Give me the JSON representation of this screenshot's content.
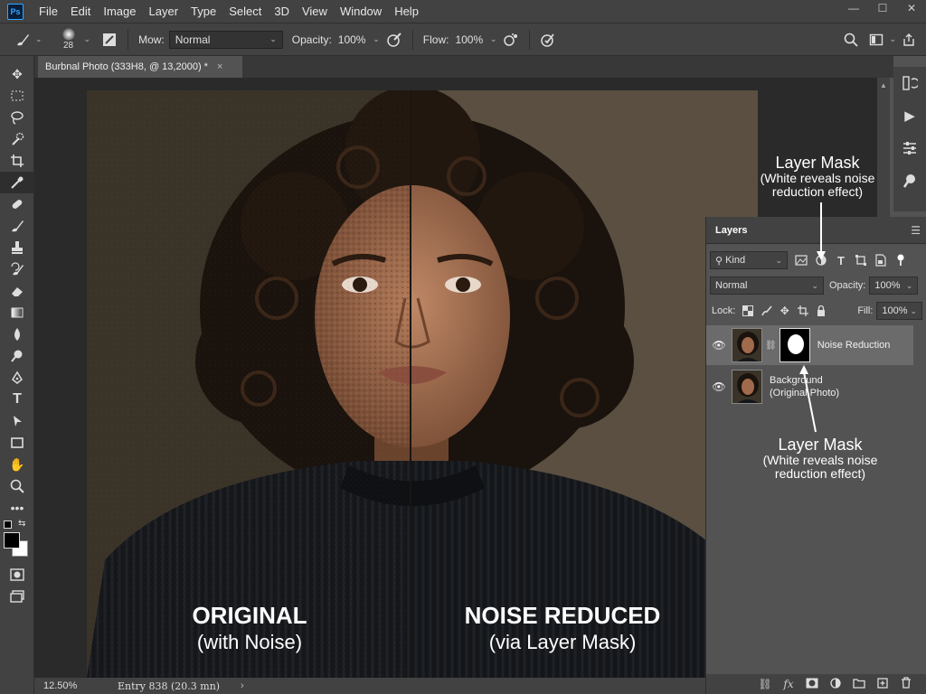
{
  "app": {
    "logo": "Ps"
  },
  "menu": [
    "File",
    "Edit",
    "Image",
    "Layer",
    "Type",
    "Select",
    "3D",
    "View",
    "Window",
    "Help"
  ],
  "window_controls": {
    "minimize": "—",
    "maximize": "☐",
    "close": "✕"
  },
  "options": {
    "brush_size": "28",
    "mode_label": "Mow:",
    "mode_value": "Normal",
    "opacity_label": "Opacity:",
    "opacity_value": "100%",
    "flow_label": "Flow:",
    "flow_value": "100%"
  },
  "document": {
    "tab_title": "Burbnal Photo (333H8, @ 13,2000) *",
    "tab_close": "×"
  },
  "canvas": {
    "left_title": "ORIGINAL",
    "left_sub": "(with Noise)",
    "right_title": "NOISE REDUCED",
    "right_sub": "(via Layer Mask)"
  },
  "layers_panel": {
    "tab": "Layers",
    "kind_label": "Kind",
    "blend_mode": "Normal",
    "opacity_label": "Opacity:",
    "opacity_value": "100%",
    "lock_label": "Lock:",
    "fill_label": "Fill:",
    "fill_value": "100%",
    "layers": [
      {
        "name": "Noise Reduction",
        "selected": true,
        "has_mask": true
      },
      {
        "name_line1": "Background",
        "name_line2": "(Original Photo)",
        "selected": false,
        "has_mask": false
      }
    ]
  },
  "annotations": {
    "top": {
      "title": "Layer Mask",
      "line1": "(White reveals noise",
      "line2": "reduction effect)"
    },
    "bottom": {
      "title": "Layer Mask",
      "line1": "(White reveals noise",
      "line2": "reduction effect)"
    }
  },
  "status": {
    "zoom": "12.50%",
    "info": "Entry 838 (20.3 mn)",
    "arrow": "›"
  },
  "colors": {
    "ui_dark": "#424242",
    "ui_mid": "#535353",
    "accent": "#31a8ff",
    "photo_bg_noisy": "#3a3328",
    "photo_bg_clean": "#5a4f40"
  }
}
